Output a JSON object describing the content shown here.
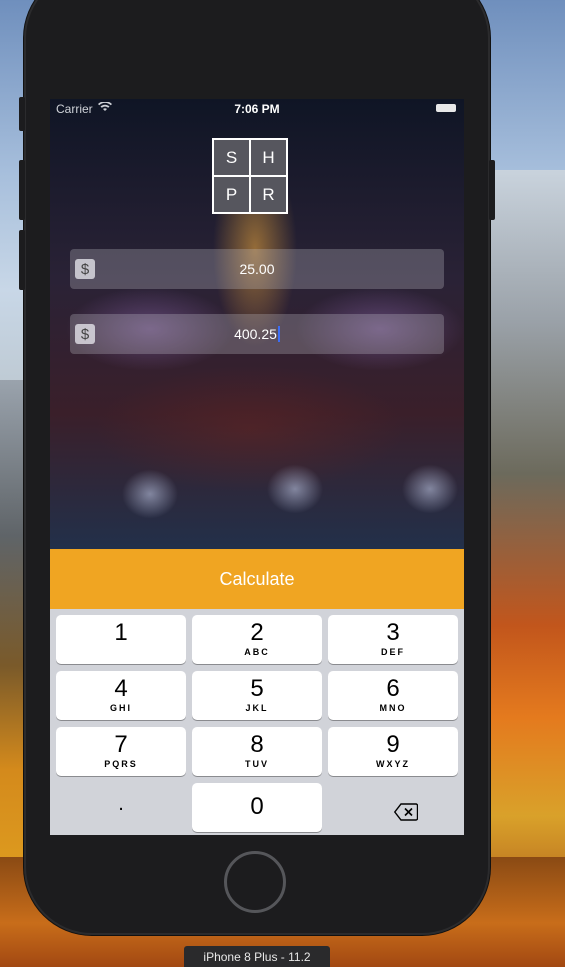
{
  "status_bar": {
    "carrier": "Carrier",
    "wifi_icon": "wifi-icon",
    "time": "7:06 PM",
    "battery_icon": "battery-icon"
  },
  "logo": {
    "letters": [
      "S",
      "H",
      "P",
      "R"
    ]
  },
  "fields": [
    {
      "currency": "$",
      "value": "25.00"
    },
    {
      "currency": "$",
      "value": "400.25"
    }
  ],
  "calculate_label": "Calculate",
  "keypad": {
    "keys": [
      {
        "digit": "1",
        "letters": ""
      },
      {
        "digit": "2",
        "letters": "ABC"
      },
      {
        "digit": "3",
        "letters": "DEF"
      },
      {
        "digit": "4",
        "letters": "GHI"
      },
      {
        "digit": "5",
        "letters": "JKL"
      },
      {
        "digit": "6",
        "letters": "MNO"
      },
      {
        "digit": "7",
        "letters": "PQRS"
      },
      {
        "digit": "8",
        "letters": "TUV"
      },
      {
        "digit": "9",
        "letters": "WXYZ"
      },
      {
        "digit": ".",
        "letters": ""
      },
      {
        "digit": "0",
        "letters": ""
      }
    ],
    "backspace_icon": "backspace-icon"
  },
  "device_label": "iPhone 8 Plus - 11.2",
  "colors": {
    "accent": "#f0a522",
    "keypad_bg": "#d1d3d9",
    "cursor": "#3c6ef5"
  }
}
